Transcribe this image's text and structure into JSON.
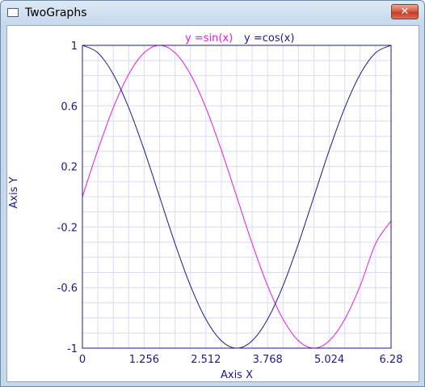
{
  "window": {
    "title": "TwoGraphs",
    "close_glyph": "✕",
    "icon": "window-app-icon"
  },
  "chart_data": {
    "type": "line",
    "xlabel": "Axis X",
    "ylabel": "Axis Y",
    "xlim": [
      0,
      6.28
    ],
    "ylim": [
      -1,
      1
    ],
    "x_ticks": [
      "0",
      "1.256",
      "2.512",
      "3.768",
      "5.024",
      "6.28"
    ],
    "y_ticks": [
      "1",
      "0.6",
      "0.2",
      "-0.2",
      "-0.6",
      "-1"
    ],
    "grid": true,
    "legend_position": "top-center",
    "series": [
      {
        "name": "y =sin(x)",
        "color": "#e619e6",
        "x": [
          0,
          0.314,
          0.628,
          0.942,
          1.256,
          1.57,
          1.884,
          2.198,
          2.512,
          2.826,
          3.14,
          3.454,
          3.768,
          4.082,
          4.396,
          4.71,
          5.024,
          5.338,
          5.652,
          5.966,
          6.28
        ],
        "values": [
          0,
          0.309,
          0.588,
          0.809,
          0.951,
          1,
          0.951,
          0.809,
          0.588,
          0.309,
          0,
          -0.309,
          -0.588,
          -0.809,
          -0.951,
          -1,
          -0.951,
          -0.809,
          -0.588,
          -0.309,
          -0.16
        ]
      },
      {
        "name": "y =cos(x)",
        "color": "#1a1a8c",
        "x": [
          0,
          0.314,
          0.628,
          0.942,
          1.256,
          1.57,
          1.884,
          2.198,
          2.512,
          2.826,
          3.14,
          3.454,
          3.768,
          4.082,
          4.396,
          4.71,
          5.024,
          5.338,
          5.652,
          5.966,
          6.28
        ],
        "values": [
          1,
          0.951,
          0.809,
          0.588,
          0.309,
          0,
          -0.309,
          -0.588,
          -0.809,
          -0.951,
          -1,
          -0.951,
          -0.809,
          -0.588,
          -0.309,
          0,
          0.309,
          0.588,
          0.809,
          0.951,
          1
        ]
      }
    ],
    "colors": {
      "frame": "#1a1a8c",
      "grid": "#d9dcf2"
    }
  }
}
